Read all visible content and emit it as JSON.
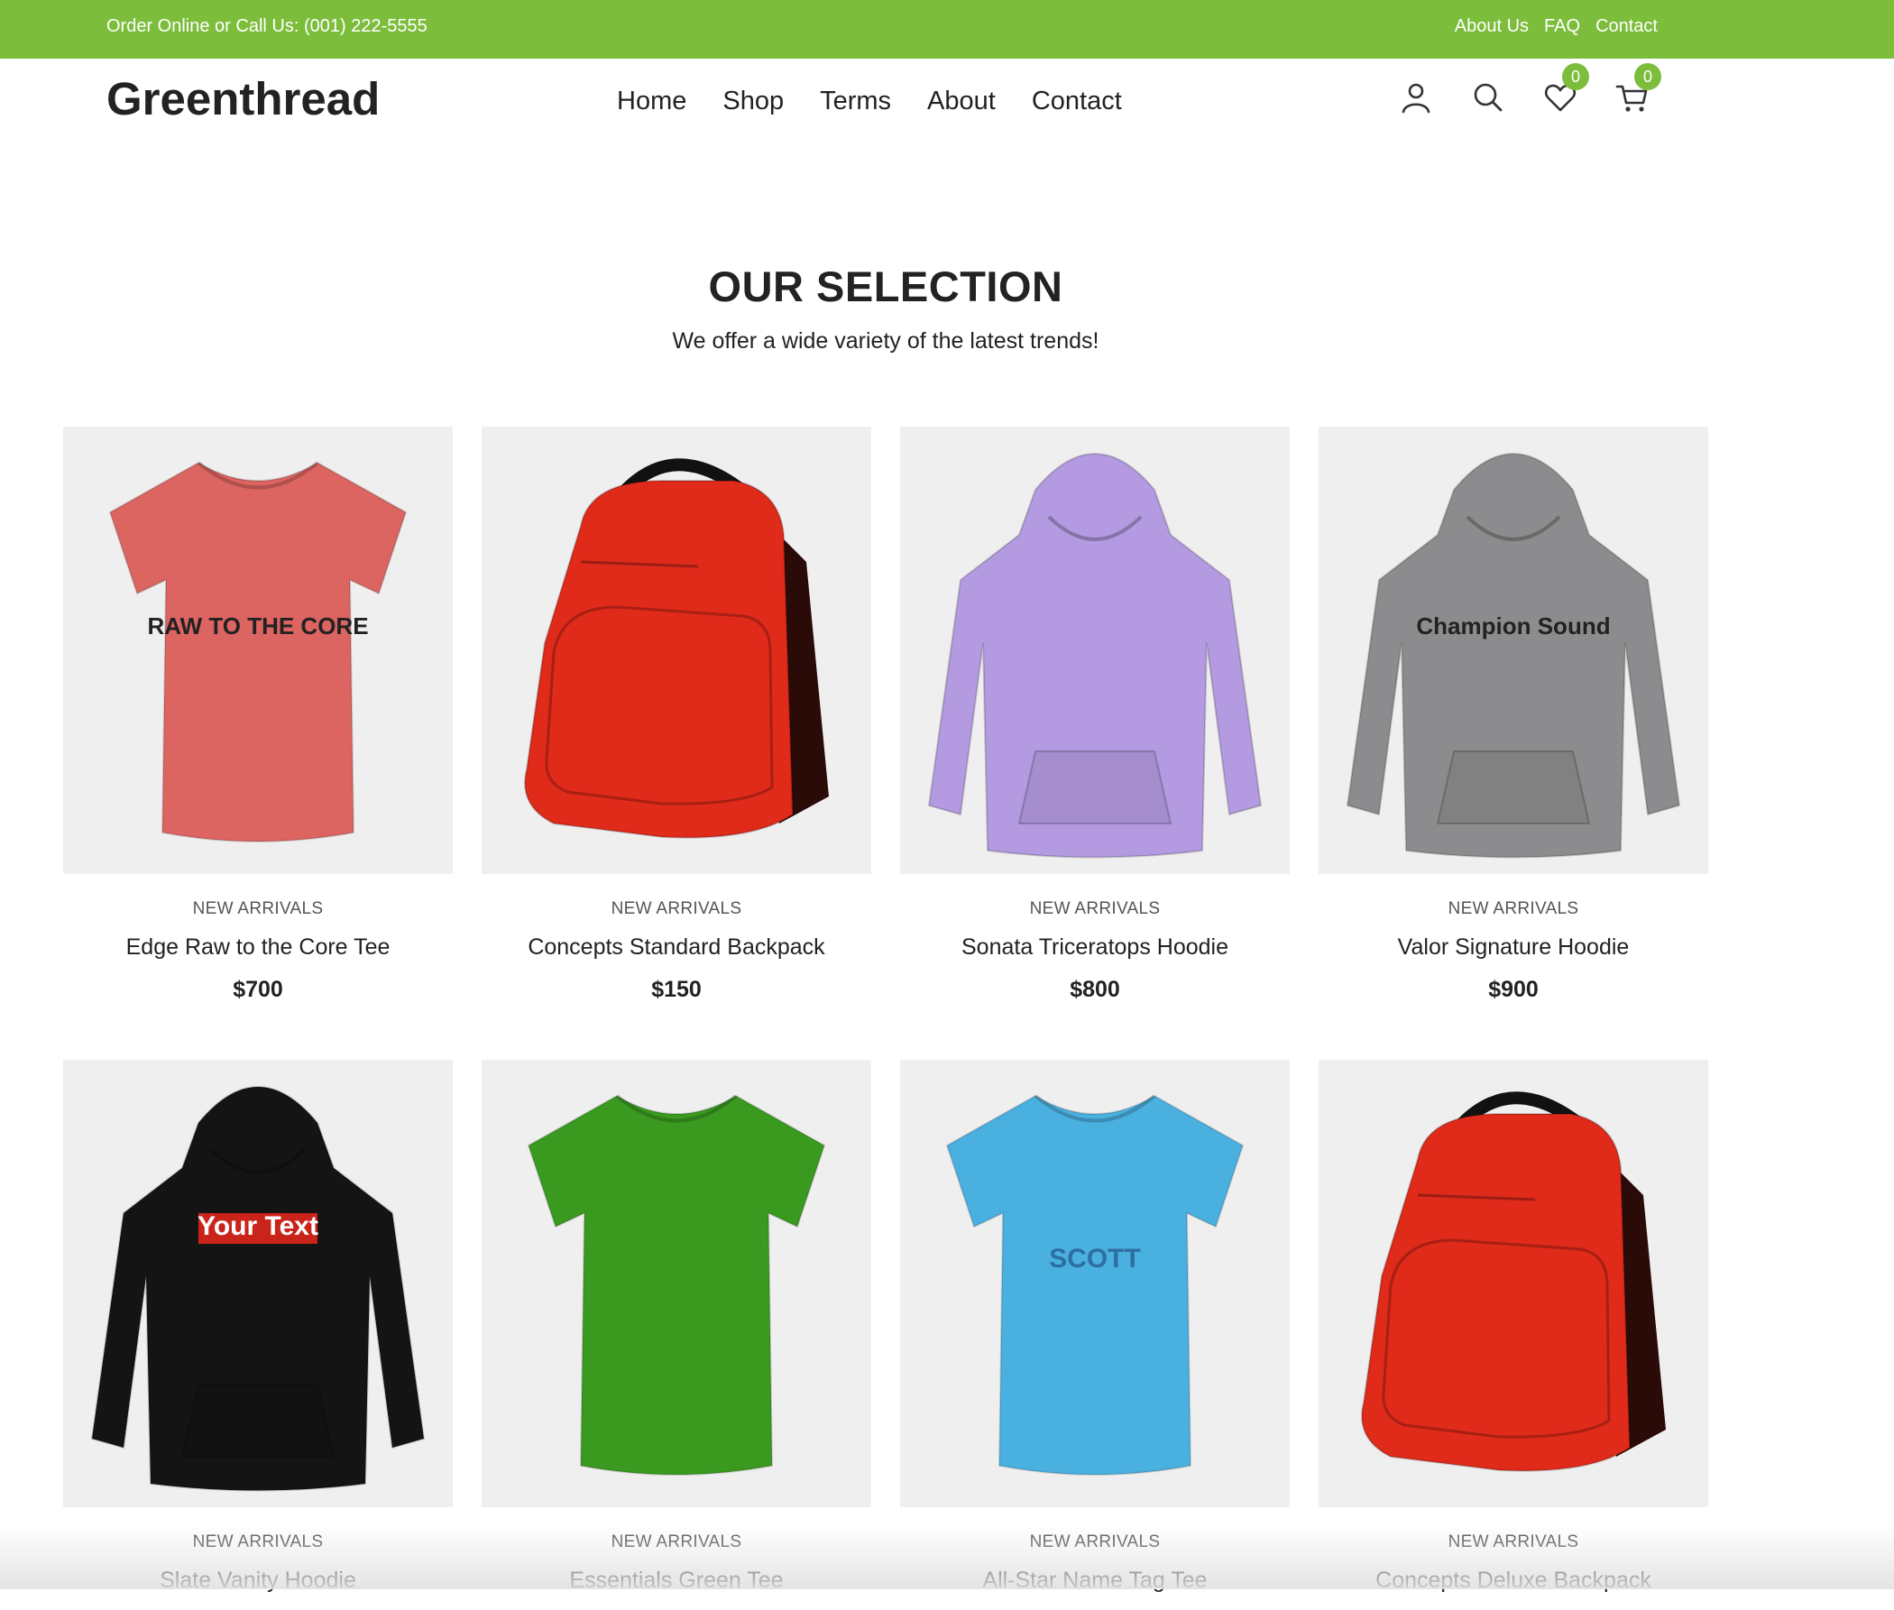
{
  "topbar": {
    "phone_text": "Order Online or Call Us: (001) 222-5555",
    "links": [
      "About Us",
      "FAQ",
      "Contact"
    ]
  },
  "header": {
    "logo": "Greenthread",
    "nav": [
      "Home",
      "Shop",
      "Terms",
      "About",
      "Contact"
    ],
    "icons": [
      "user-icon",
      "search-icon",
      "heart-icon",
      "cart-icon"
    ],
    "wishlist_count": "0",
    "cart_count": "0"
  },
  "section": {
    "title": "OUR SELECTION",
    "subtitle": "We offer a wide variety of the latest trends!"
  },
  "products": [
    {
      "category": "NEW ARRIVALS",
      "name": "Edge Raw to the Core Tee",
      "price": "$700",
      "garment": "tee",
      "color": "#dc6461",
      "print": "RAW TO THE CORE"
    },
    {
      "category": "NEW ARRIVALS",
      "name": "Concepts Standard Backpack",
      "price": "$150",
      "garment": "backpack",
      "color": "#e02a1a"
    },
    {
      "category": "NEW ARRIVALS",
      "name": "Sonata Triceratops Hoodie",
      "price": "$800",
      "garment": "hoodie",
      "color": "#b49ae0"
    },
    {
      "category": "NEW ARRIVALS",
      "name": "Valor Signature Hoodie",
      "price": "$900",
      "garment": "hoodie",
      "color": "#8c8c8e",
      "print": "Champion Sound"
    },
    {
      "category": "NEW ARRIVALS",
      "name": "Slate Vanity Hoodie",
      "price": "",
      "garment": "hoodie",
      "color": "#141414",
      "print": "Your Text"
    },
    {
      "category": "NEW ARRIVALS",
      "name": "Essentials Green Tee",
      "price": "",
      "garment": "tee",
      "color": "#3a9a20"
    },
    {
      "category": "NEW ARRIVALS",
      "name": "All-Star Name Tag Tee",
      "price": "",
      "garment": "tee",
      "color": "#4ab0df",
      "print": "SCOTT"
    },
    {
      "category": "NEW ARRIVALS",
      "name": "Concepts Deluxe Backpack",
      "price": "",
      "garment": "backpack",
      "color": "#e02a1a"
    }
  ],
  "colors": {
    "accent": "#7cbd3c",
    "image_bg": "#efefef",
    "text": "#222222"
  }
}
